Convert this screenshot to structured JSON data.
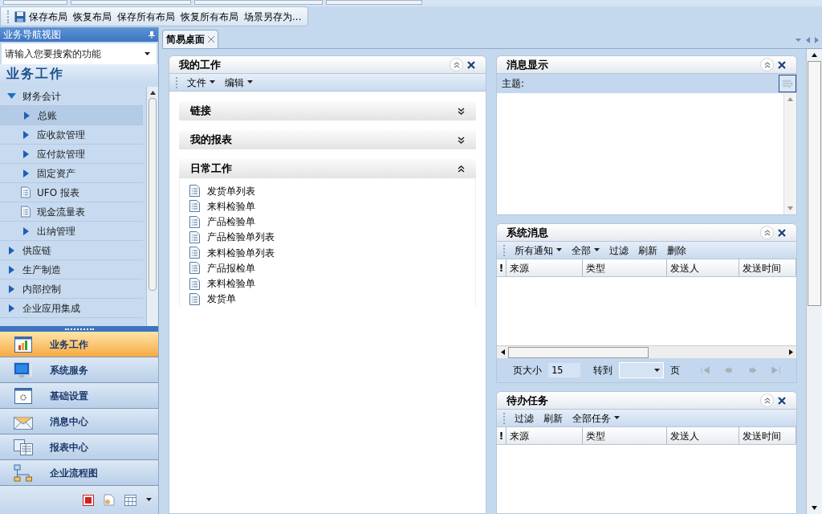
{
  "toolbar": [
    {
      "label": "保存布局",
      "kind": "save"
    },
    {
      "label": "恢复布局",
      "kind": "text"
    },
    {
      "label": "保存所有布局",
      "kind": "text"
    },
    {
      "label": "恢复所有布局",
      "kind": "text"
    },
    {
      "label": "场景另存为...",
      "kind": "text"
    }
  ],
  "sidebar": {
    "title": "业务导航视图",
    "search": {
      "placeholder": "请输入您要搜索的功能"
    },
    "section_title": "业务工作",
    "tree": [
      {
        "label": "财务会计",
        "expanded": true,
        "selected": false,
        "children": [
          {
            "label": "总账",
            "kind": "folder",
            "selected": true
          },
          {
            "label": "应收款管理",
            "kind": "folder",
            "selected": false
          },
          {
            "label": "应付款管理",
            "kind": "folder",
            "selected": false
          },
          {
            "label": "固定资产",
            "kind": "folder",
            "selected": false
          },
          {
            "label": "UFO 报表",
            "kind": "document",
            "selected": false
          },
          {
            "label": "现金流量表",
            "kind": "document",
            "selected": false
          },
          {
            "label": "出纳管理",
            "kind": "folder",
            "selected": false
          }
        ]
      },
      {
        "label": "供应链",
        "expanded": false,
        "selected": false
      },
      {
        "label": "生产制造",
        "expanded": false,
        "selected": false
      },
      {
        "label": "内部控制",
        "expanded": false,
        "selected": false
      },
      {
        "label": "企业应用集成",
        "expanded": false,
        "selected": false
      }
    ],
    "nav_buttons": [
      {
        "label": "业务工作",
        "kind": "chart",
        "selected": true
      },
      {
        "label": "系统服务",
        "kind": "monitor",
        "selected": false
      },
      {
        "label": "基础设置",
        "kind": "gear",
        "selected": false
      },
      {
        "label": "消息中心",
        "kind": "mail",
        "selected": false
      },
      {
        "label": "报表中心",
        "kind": "report",
        "selected": false
      },
      {
        "label": "企业流程图",
        "kind": "flow",
        "selected": false
      }
    ]
  },
  "tabs": [
    {
      "label": "简易桌面",
      "selected": true
    }
  ],
  "my_work": {
    "title": "我的工作",
    "menus": [
      "文件",
      "编辑"
    ],
    "sections": [
      {
        "title": "链接",
        "expanded": false
      },
      {
        "title": "我的报表",
        "expanded": false
      },
      {
        "title": "日常工作",
        "expanded": true,
        "items": [
          "发货单列表",
          "来料检验单",
          "产品检验单",
          "产品检验单列表",
          "来料检验单列表",
          "产品报检单",
          "来料检验单",
          "发货单"
        ]
      }
    ]
  },
  "message_display": {
    "title": "消息显示",
    "subject_label": "主题:"
  },
  "system_messages": {
    "title": "系统消息",
    "toolbar": [
      {
        "label": "所有通知",
        "dropdown": true
      },
      {
        "label": "全部",
        "dropdown": true
      },
      {
        "label": "过滤",
        "dropdown": false
      },
      {
        "label": "刷新",
        "dropdown": false
      },
      {
        "label": "删除",
        "dropdown": false
      }
    ],
    "columns": [
      "!",
      "来源",
      "类型",
      "发送人",
      "发送时间"
    ],
    "pager": {
      "page_size_label": "页大小",
      "page_size": "15",
      "goto_label": "转到",
      "page_label": "页"
    }
  },
  "todo": {
    "title": "待办任务",
    "toolbar": [
      {
        "label": "过滤",
        "dropdown": false
      },
      {
        "label": "刷新",
        "dropdown": false
      },
      {
        "label": "全部任务",
        "dropdown": true
      }
    ],
    "columns": [
      "!",
      "来源",
      "类型",
      "发送人",
      "发送时间"
    ]
  }
}
